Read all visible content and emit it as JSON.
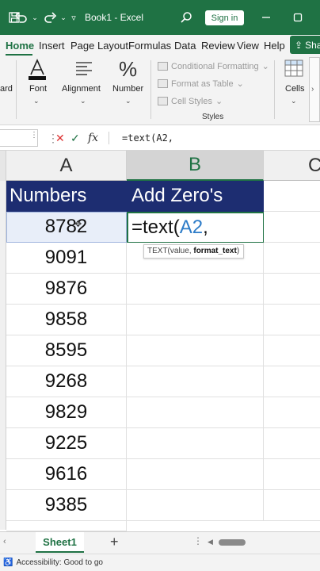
{
  "titlebar": {
    "title": "Book1 - Excel",
    "signin_label": "Sign in",
    "colors": {
      "brand": "#1f7244"
    }
  },
  "tabs": [
    {
      "label": "Home",
      "active": true
    },
    {
      "label": "Insert"
    },
    {
      "label": "Page Layout"
    },
    {
      "label": "Formulas"
    },
    {
      "label": "Data"
    },
    {
      "label": "Review"
    },
    {
      "label": "View"
    },
    {
      "label": "Help"
    }
  ],
  "share_label": "Sha",
  "ribbon": {
    "clipboard_label": "ard",
    "font_label": "Font",
    "alignment_label": "Alignment",
    "number_label": "Number",
    "conditional_formatting": "Conditional Formatting",
    "format_as_table": "Format as Table",
    "cell_styles": "Cell Styles",
    "styles_group_label": "Styles",
    "cells_label": "Cells"
  },
  "formula_bar": {
    "value": "=text(A2,"
  },
  "columns": [
    "A",
    "B",
    "C"
  ],
  "headers": {
    "a": "Numbers",
    "b": "Add  Zero's"
  },
  "numbers": [
    "8782",
    "9091",
    "9876",
    "9858",
    "8595",
    "9268",
    "9829",
    "9225",
    "9616",
    "9385"
  ],
  "active_cell": {
    "prefix": "=text(",
    "ref": "A2",
    "suffix": ","
  },
  "tooltip": {
    "fn": "TEXT(value, ",
    "arg": "format_text",
    "end": ")"
  },
  "sheet_tab": "Sheet1",
  "status": {
    "accessibility": "Accessibility: Good to go"
  },
  "colors": {
    "header_fill": "#1d2d71",
    "ref_blue": "#2d7cc8"
  }
}
